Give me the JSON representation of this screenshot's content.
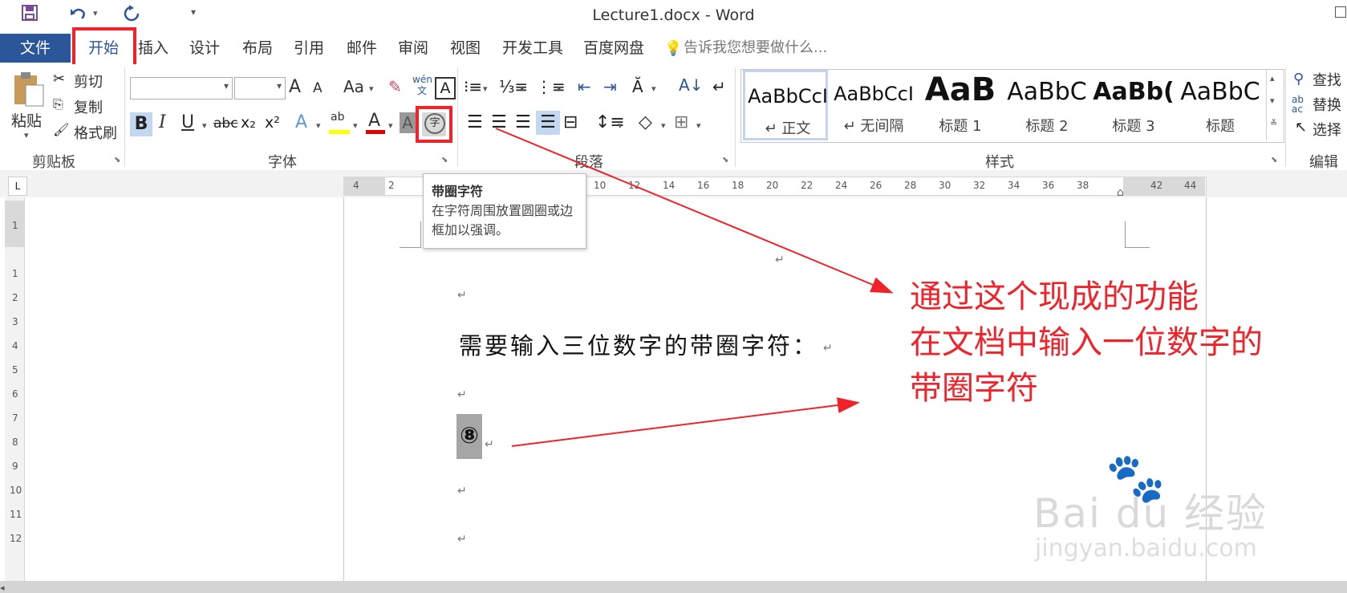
{
  "window": {
    "title": "Lecture1.docx - Word"
  },
  "tabs": {
    "file": "文件",
    "items": [
      "开始",
      "插入",
      "设计",
      "布局",
      "引用",
      "邮件",
      "审阅",
      "视图",
      "开发工具",
      "百度网盘"
    ],
    "tell_me": "告诉我您想要做什么..."
  },
  "clipboard": {
    "paste": "粘贴",
    "cut": "剪切",
    "copy": "复制",
    "format_painter": "格式刷",
    "group_label": "剪贴板"
  },
  "font": {
    "group_label": "字体",
    "bold": "B",
    "italic": "I",
    "underline": "U",
    "strike": "abc",
    "subscript": "x₂",
    "superscript": "x²",
    "change_case": "Aa",
    "grow": "A",
    "shrink": "A",
    "pinyin": "wén 文",
    "border_char": "A",
    "enclose_glyph": "字"
  },
  "paragraph": {
    "group_label": "段落"
  },
  "styles": {
    "group_label": "样式",
    "items": [
      {
        "sample": "AaBbCcI",
        "name": "↵ 正文"
      },
      {
        "sample": "AaBbCcI",
        "name": "↵ 无间隔"
      },
      {
        "sample": "AaB",
        "name": "标题 1"
      },
      {
        "sample": "AaBbC",
        "name": "标题 2"
      },
      {
        "sample": "AaBb(",
        "name": "标题 3"
      },
      {
        "sample": "AaBbC",
        "name": "标题"
      }
    ]
  },
  "editing": {
    "group_label": "编辑",
    "find": "查找",
    "replace": "替换",
    "select": "选择"
  },
  "ruler": {
    "numbers": [
      "4",
      "2",
      "10",
      "12",
      "14",
      "16",
      "18",
      "20",
      "22",
      "24",
      "26",
      "28",
      "30",
      "32",
      "34",
      "36",
      "38",
      "42",
      "44"
    ]
  },
  "vruler": {
    "numbers": [
      "1",
      "1",
      "2",
      "3",
      "4",
      "5",
      "6",
      "7",
      "8",
      "9",
      "10",
      "11",
      "12"
    ]
  },
  "tooltip": {
    "title": "带圈字符",
    "body": "在字符周围放置圆圈或边框加以强调。"
  },
  "document": {
    "line1": "需要输入三位数字的带圈字符：",
    "enclosed_char": "⑧",
    "para_mark": "↵"
  },
  "annotation": {
    "line1": "通过这个现成的功能",
    "line2": "在文档中输入一位数字的",
    "line3": "带圈字符"
  },
  "watermark": {
    "brand": "Bai du 经验",
    "url": "jingyan.baidu.com"
  },
  "colors": {
    "accent": "#2b579a",
    "highlight_red": "#f0232a"
  }
}
